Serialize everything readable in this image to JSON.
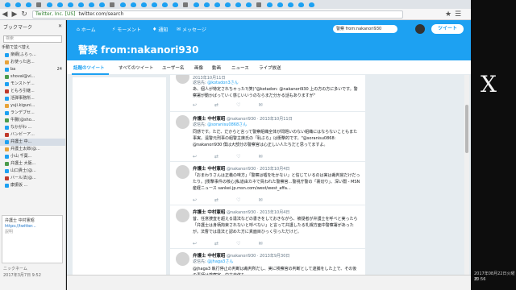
{
  "browser": {
    "tab_count_birds": 30,
    "url_site": "Twitter, Inc. [US]",
    "url_path": "twitter.com/search"
  },
  "sidebar": {
    "title": "ブックマーク",
    "search_placeholder": "検索",
    "section_label": "手動で並べ替え",
    "items": [
      {
        "label": "楽網(ふらっ..."
      },
      {
        "label": "お使った店..."
      },
      {
        "label": "ba",
        "badge": "24"
      },
      {
        "label": "shoval@vi..."
      },
      {
        "label": "モンストゲ..."
      },
      {
        "label": "ともろ引継..."
      },
      {
        "label": "活弾事務所..."
      },
      {
        "label": "yuji.kiguni..."
      },
      {
        "label": "ランデブセ..."
      },
      {
        "label": "牛腸(@sho..."
      },
      {
        "label": "なかがわ ..."
      },
      {
        "label": "バンビーア..."
      },
      {
        "label": "弁護士 中..."
      },
      {
        "label": "弁護士太郎(@..."
      },
      {
        "label": "小山 千葉..."
      },
      {
        "label": "弁護士 大阪..."
      },
      {
        "label": "山口貴士(@..."
      },
      {
        "label": "バール法(@..."
      },
      {
        "label": "康振仮 ..."
      }
    ],
    "preview_title": "弁護士 中村憲昭",
    "preview_link": "https://twitter...",
    "preview_note": "説明",
    "foot_label": "ニックネーム",
    "foot_date": "2017年3月7日 9:52"
  },
  "twitter": {
    "nav": {
      "home": "ホーム",
      "moments": "モーメント",
      "notifications": "通知",
      "messages": "メッセージ"
    },
    "search_value": "警察 from:nakanori930",
    "tweet_button": "ツイート",
    "banner_title": "警察 from:nakanori930",
    "tabs": [
      "話題のツイート",
      "すべてのツイート",
      "ユーザー名",
      "画像",
      "動画",
      "ニュース",
      "ライブ放送"
    ],
    "tweets": [
      {
        "name": "",
        "handle": "",
        "date": "2013年10月11日",
        "reply_label": "返信先:",
        "reply_to": "@kotadon3さん",
        "body": "あ、個人が特定されちゃった?(笑)\"@kotadon: @nakanori930 上の方の方に多いです。警察署が動かばっていく感じいいうのならまだ分かる話もありますが\""
      },
      {
        "name": "弁護士 中村憲昭",
        "handle": "@nakanori930",
        "date": "2013年10月11日",
        "reply_label": "返信先:",
        "reply_to": "@soranisu0868さん",
        "body": "同感です。ただ、だからと言って警察組織全体が問題いのない組織にはならないこともまた事実。遠警元刑事の組警主席氏の「恥ぶら」は衝撃的です。\"@soranisu0868: @nakanori930 僕は大部分の警察官は心正しい人たちだと思ってますよ。"
      },
      {
        "name": "弁護士 中村憲昭",
        "handle": "@nakanori930",
        "date": "2013年10月4日",
        "reply_label": "",
        "reply_to": "",
        "body": "「おまわりさんは正義の味方」「警察は嘘を吐かない」と信じているのは実は裁判官だけだったり。[衝撃事件の核心]私道由カネで買われた警察官…警視庁警の「裏切り」、深い闇 - MSN産経ニュース sankei.jp.msn.com/west/west_affa..."
      },
      {
        "name": "弁護士 中村憲昭",
        "handle": "@nakanori930",
        "date": "2013年10月4日",
        "reply_label": "",
        "reply_to": "",
        "body": "昔、任意捜査を超える違法などの書きをしておきながら、被疑者が弁護士を呼べと実ったら「弁護士は身柄拘束されないと呼べない」と言って弁護したる札幌方面中警察署があったが。法曹では違法と認めた方に真面目ひっく引っただけど。"
      },
      {
        "name": "弁護士 中村憲昭",
        "handle": "@nakanori930",
        "date": "2013年9月30日",
        "reply_label": "返信先:",
        "reply_to": "@jhaga3さん",
        "body": "@jhaga3 執行停止の判断は裁判所だし、実に検察官の判断として逮捕をした上で、その後の事柄は検察官、中立自体も"
      }
    ]
  },
  "os": {
    "panel_text": "X",
    "clock": "20:56",
    "date_text": "2017年08月22日火曜日"
  }
}
